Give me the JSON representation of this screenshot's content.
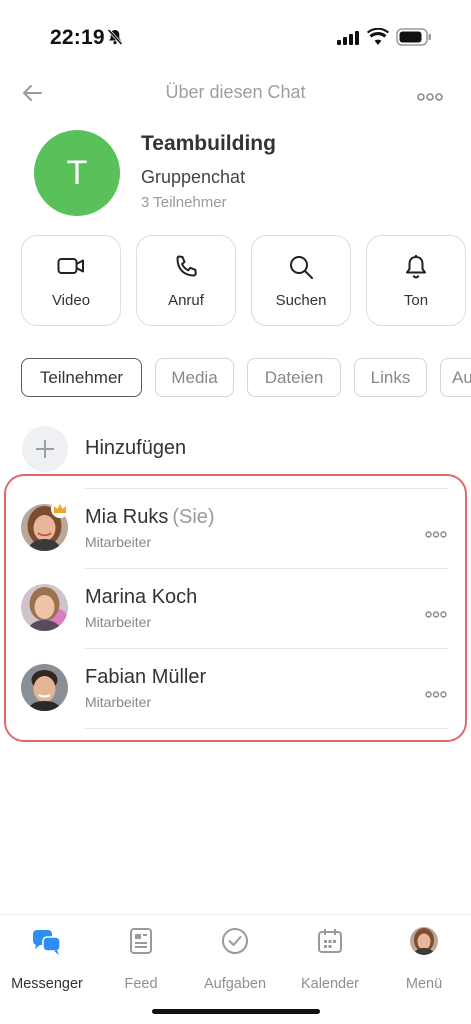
{
  "status_bar": {
    "time": "22:19"
  },
  "nav": {
    "title": "Über diesen Chat"
  },
  "chat": {
    "avatar_letter": "T",
    "avatar_color": "#5ac05a",
    "name": "Teambuilding",
    "type": "Gruppenchat",
    "members_count": "3 Teilnehmer"
  },
  "actions": [
    {
      "label": "Video",
      "icon": "video-icon"
    },
    {
      "label": "Anruf",
      "icon": "phone-icon"
    },
    {
      "label": "Suchen",
      "icon": "search-icon"
    },
    {
      "label": "Ton",
      "icon": "bell-icon"
    }
  ],
  "tabs": [
    {
      "label": "Teilnehmer",
      "active": true
    },
    {
      "label": "Media",
      "active": false
    },
    {
      "label": "Dateien",
      "active": false
    },
    {
      "label": "Links",
      "active": false
    },
    {
      "label": "Au",
      "active": false
    }
  ],
  "add_member": {
    "label": "Hinzufügen"
  },
  "members": [
    {
      "name": "Mia Ruks",
      "suffix": "(Sie)",
      "role": "Mitarbeiter",
      "crown": true
    },
    {
      "name": "Marina Koch",
      "suffix": "",
      "role": "Mitarbeiter",
      "crown": false
    },
    {
      "name": "Fabian Müller",
      "suffix": "",
      "role": "Mitarbeiter",
      "crown": false
    }
  ],
  "highlight_color": "#e06a6a",
  "tabbar": [
    {
      "label": "Messenger",
      "icon": "messenger-icon",
      "active": true
    },
    {
      "label": "Feed",
      "icon": "feed-icon",
      "active": false
    },
    {
      "label": "Aufgaben",
      "icon": "tasks-icon",
      "active": false
    },
    {
      "label": "Kalender",
      "icon": "calendar-icon",
      "active": false
    },
    {
      "label": "Menü",
      "icon": "menu-avatar",
      "active": false
    }
  ],
  "accent_color": "#2f8ef4"
}
